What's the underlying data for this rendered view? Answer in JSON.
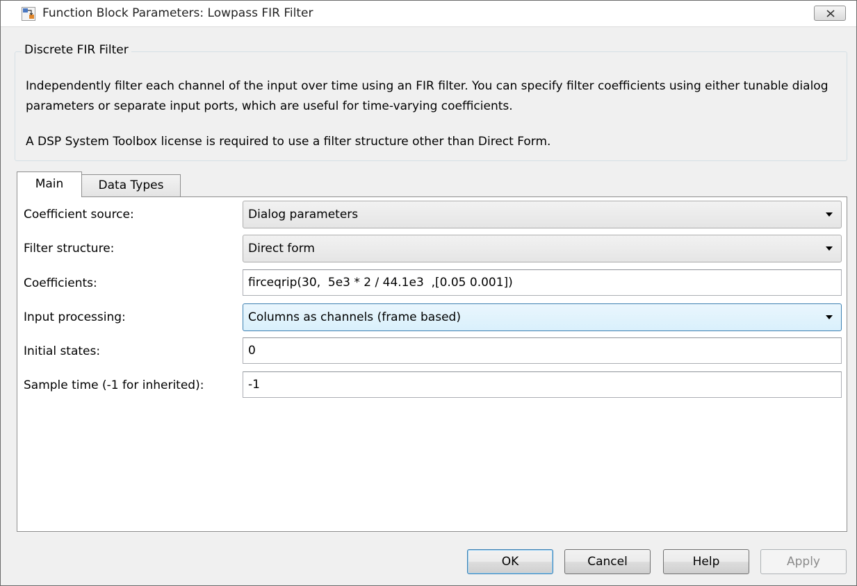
{
  "window": {
    "title": "Function Block Parameters: Lowpass FIR Filter"
  },
  "block": {
    "name": "Discrete FIR Filter",
    "description": "Independently filter each channel of the input over time using an FIR filter. You can specify filter coefficients using either tunable dialog parameters or separate input ports, which are useful for time-varying coefficients.",
    "license_note": "A DSP System Toolbox license is required to use a filter structure other than Direct Form."
  },
  "tabs": [
    {
      "label": "Main",
      "active": true
    },
    {
      "label": "Data Types",
      "active": false
    }
  ],
  "fields": {
    "coefficient_source": {
      "label": "Coefficient source:",
      "value": "Dialog parameters"
    },
    "filter_structure": {
      "label": "Filter structure:",
      "value": "Direct form"
    },
    "coefficients": {
      "label": "Coefficients:",
      "value": "firceqrip(30,  5e3 * 2 / 44.1e3  ,[0.05 0.001])"
    },
    "input_processing": {
      "label": "Input processing:",
      "value": "Columns as channels (frame based)"
    },
    "initial_states": {
      "label": "Initial states:",
      "value": "0"
    },
    "sample_time": {
      "label": "Sample time (-1 for inherited):",
      "value": "-1"
    }
  },
  "buttons": {
    "ok": "OK",
    "cancel": "Cancel",
    "help": "Help",
    "apply": "Apply"
  },
  "icons": {
    "app": "simulink-block-icon",
    "close": "close-icon"
  },
  "colors": {
    "focus_border": "#3c7fb1",
    "window_bg": "#f0f0f0"
  }
}
